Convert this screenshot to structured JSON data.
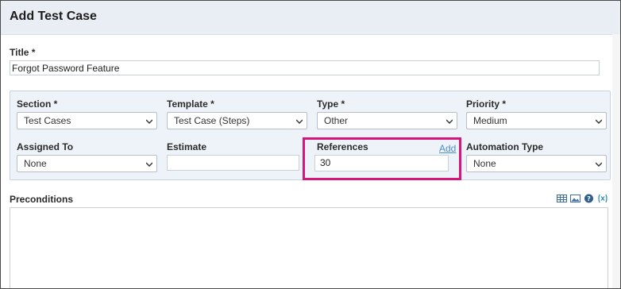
{
  "dialog": {
    "title": "Add Test Case"
  },
  "title_field": {
    "label": "Title *",
    "value": "Forgot Password Feature"
  },
  "section": {
    "label": "Section *",
    "value": "Test Cases"
  },
  "template": {
    "label": "Template *",
    "value": "Test Case (Steps)"
  },
  "type": {
    "label": "Type *",
    "value": "Other"
  },
  "priority": {
    "label": "Priority *",
    "value": "Medium"
  },
  "assigned_to": {
    "label": "Assigned To",
    "value": "None"
  },
  "estimate": {
    "label": "Estimate",
    "value": ""
  },
  "references": {
    "label": "References",
    "add_label": "Add",
    "value": "30"
  },
  "automation_type": {
    "label": "Automation Type",
    "value": "None"
  },
  "preconditions": {
    "label": "Preconditions",
    "value": ""
  },
  "toolbar_icons": [
    "table-icon",
    "image-icon",
    "help-icon",
    "markdown-icon"
  ],
  "colors": {
    "highlight": "#d6167a",
    "link": "#4b8dc9",
    "panel": "#eef3f9",
    "header": "#e9eef5"
  }
}
